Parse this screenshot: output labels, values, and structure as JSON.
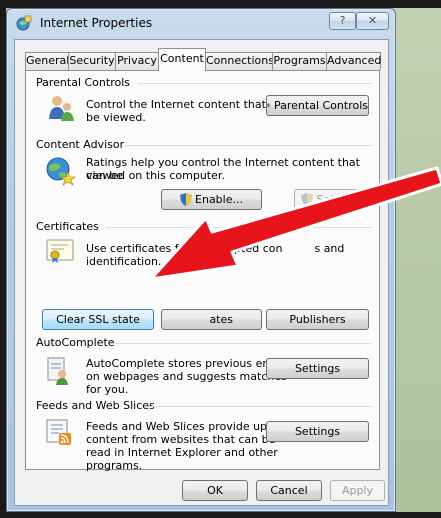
{
  "window": {
    "title": "Internet Properties",
    "help_label": "?",
    "close_label": "✕"
  },
  "tabs": [
    {
      "label": "General"
    },
    {
      "label": "Security"
    },
    {
      "label": "Privacy"
    },
    {
      "label": "Content"
    },
    {
      "label": "Connections"
    },
    {
      "label": "Programs"
    },
    {
      "label": "Advanced"
    }
  ],
  "parental_controls": {
    "header": "Parental Controls",
    "description_line1": "Control the Internet content that can",
    "description_line2": "be viewed.",
    "button_label": "Parental Controls"
  },
  "content_advisor": {
    "header": "Content Advisor",
    "description_line1": "Ratings help you control the Internet content that can be",
    "description_line2": "viewed on this computer.",
    "enable_label": "Enable...",
    "settings_label": "Settings"
  },
  "certificates": {
    "header": "Certificates",
    "description_pre": "Use certificates for e",
    "description_mid": "pted con",
    "description_post": "s and identification.",
    "clear_ssl_label": "Clear SSL state",
    "certificates_label": "ates",
    "publishers_label": "Publishers"
  },
  "autocomplete": {
    "header": "AutoComplete",
    "description_line1": "AutoComplete stores previous entries",
    "description_line2": "on webpages and suggests matches",
    "description_line3": "for you.",
    "settings_label": "Settings"
  },
  "feeds": {
    "header": "Feeds and Web Slices",
    "description_line1": "Feeds and Web Slices provide updated",
    "description_line2": "content from websites that can be",
    "description_line3": "read in Internet Explorer and other",
    "description_line4": "programs.",
    "settings_label": "Settings"
  },
  "footer": {
    "ok_label": "OK",
    "cancel_label": "Cancel",
    "apply_label": "Apply"
  },
  "colors": {
    "arrow": "#e8141b",
    "accent": "#3c7fb1"
  }
}
